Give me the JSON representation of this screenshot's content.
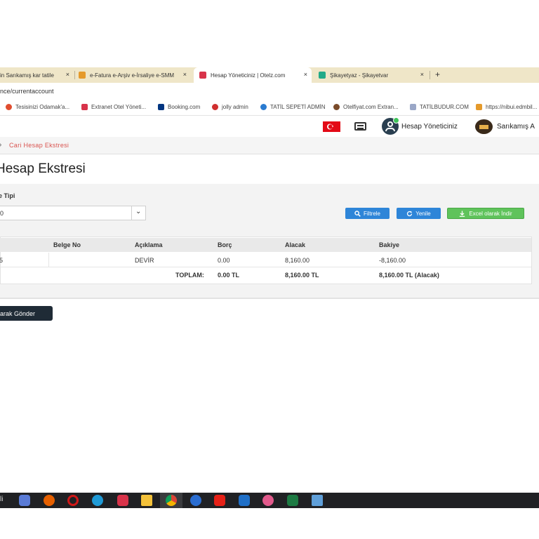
{
  "browser": {
    "tabs": [
      {
        "title": "in Sarıkamış kar tatile",
        "close": "×",
        "favicon_color": "#cc3333",
        "active": false
      },
      {
        "title": "e-Fatura e-Arşiv e-İrsaliye e-SMM",
        "close": "×",
        "favicon_color": "#e59a2b",
        "active": false
      },
      {
        "title": "Hesap Yöneticiniz | Otelz.com",
        "close": "×",
        "favicon_color": "#d8334a",
        "active": true
      },
      {
        "title": "Şikayetyaz - Şikayetvar",
        "close": "×",
        "favicon_color": "#22aa88",
        "active": false
      }
    ],
    "new_tab": "+",
    "url": "nce/currentaccount",
    "bookmarks": [
      {
        "label": "Tesisinizi Odamak'a...",
        "favicon_color": "#e04d2f"
      },
      {
        "label": "Extranet Otel Yöneti...",
        "favicon_color": "#d8334a"
      },
      {
        "label": "Booking.com",
        "favicon_color": "#003580"
      },
      {
        "label": "jolly admin",
        "favicon_color": "#d02f2f"
      },
      {
        "label": "TATİL SEPETİ ADMİN",
        "favicon_color": "#2a7bd0"
      },
      {
        "label": "Otelfiyat.com Extran...",
        "favicon_color": "#7a4b2a"
      },
      {
        "label": "TATİLBUDUR.COM",
        "favicon_color": "#9aa7c7"
      },
      {
        "label": "https://nibui.edmbil...",
        "favicon_color": "#e59a2b"
      }
    ]
  },
  "header": {
    "account_name": "Hesap Yöneticiniz",
    "hotel_name": "Sarıkamış A"
  },
  "breadcrumb": {
    "label": "Cari Hesap Ekstresi"
  },
  "page": {
    "title": "Hesap Ekstresi"
  },
  "filters": {
    "type_label": "e Tipi",
    "select_value": "0",
    "buttons": {
      "filter": "Filtrele",
      "refresh": "Yenile",
      "excel": "Excel olarak İndir"
    }
  },
  "table": {
    "columns": [
      "Belge No",
      "Açıklama",
      "Borç",
      "Alacak",
      "Bakiye"
    ],
    "rows": [
      {
        "first": "5",
        "belge_no": "",
        "aciklama": "DEVİR",
        "borc": "0.00",
        "alacak": "8,160.00",
        "bakiye": "-8,160.00"
      }
    ],
    "total": {
      "label": "TOPLAM:",
      "borc": "0.00 TL",
      "alacak": "8,160.00 TL",
      "bakiye": "8,160.00 TL (Alacak)"
    }
  },
  "send_button": "arak Gönder",
  "taskbar": {
    "left_text": "li",
    "apps": [
      {
        "name": "copilot-icon",
        "color": "#5a7bd6"
      },
      {
        "name": "firefox-icon",
        "color": "#e66000"
      },
      {
        "name": "opera-icon",
        "color": "#d01818"
      },
      {
        "name": "edge-icon",
        "color": "#1f9ad6"
      },
      {
        "name": "huawei-icon",
        "color": "#d8334a"
      },
      {
        "name": "file-explorer-icon",
        "color": "#f3c13a"
      },
      {
        "name": "chrome-icon",
        "color": "#3aa757"
      },
      {
        "name": "app-blue-icon",
        "color": "#2a6dd1"
      },
      {
        "name": "youtube-icon",
        "color": "#e62117"
      },
      {
        "name": "outlook-icon",
        "color": "#1f6fc7"
      },
      {
        "name": "app-pink-icon",
        "color": "#e25a8c"
      },
      {
        "name": "excel-icon",
        "color": "#1d7a43"
      },
      {
        "name": "notepad-icon",
        "color": "#5f9fd9"
      }
    ]
  }
}
